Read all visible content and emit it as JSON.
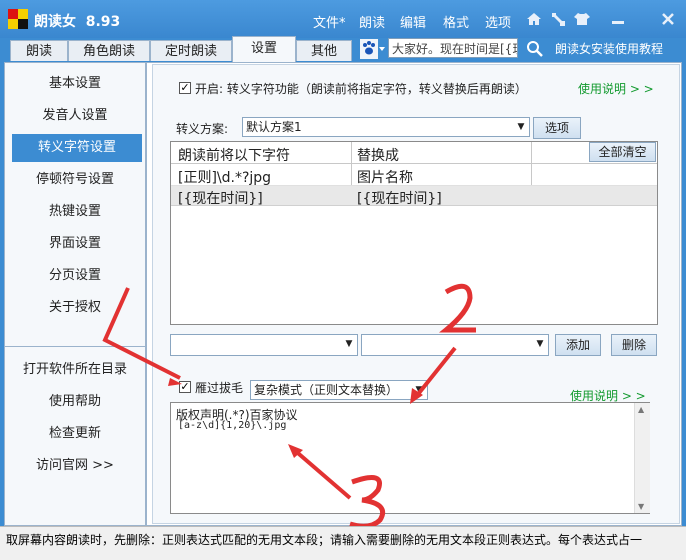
{
  "window": {
    "title": "朗读女  8.93",
    "menu": [
      "文件*",
      "朗读",
      "编辑",
      "格式",
      "选项"
    ]
  },
  "toolbar_icons": [
    "home-icon",
    "tools-icon",
    "shirt-icon",
    "minimize-icon",
    "close-icon"
  ],
  "tabs": [
    {
      "label": "朗读",
      "active": false
    },
    {
      "label": "角色朗读",
      "active": false
    },
    {
      "label": "定时朗读",
      "active": false
    },
    {
      "label": "设置",
      "active": true
    },
    {
      "label": "其他",
      "active": false
    }
  ],
  "search": {
    "value": "大家好。现在时间是[{现"
  },
  "top_help_link": "朗读女安装使用教程",
  "sidebar": {
    "items": [
      {
        "label": "基本设置",
        "selected": false
      },
      {
        "label": "发音人设置",
        "selected": false
      },
      {
        "label": "转义字符设置",
        "selected": true
      },
      {
        "label": "停顿符号设置",
        "selected": false
      },
      {
        "label": "热键设置",
        "selected": false
      },
      {
        "label": "界面设置",
        "selected": false
      },
      {
        "label": "分页设置",
        "selected": false
      },
      {
        "label": "关于授权",
        "selected": false
      }
    ],
    "bottom_items": [
      "打开软件所在目录",
      "使用帮助",
      "检查更新",
      "访问官网 >>"
    ]
  },
  "escape": {
    "enable_checked": true,
    "enable_label": "开启: 转义字符功能（朗读前将指定字符，转义替换后再朗读）",
    "help_link": "使用说明 > >",
    "scheme_label": "转义方案:",
    "scheme_value": "默认方案1",
    "options_button": "选项",
    "clear_all_button": "全部清空",
    "columns": [
      "朗读前将以下字符",
      "替换成"
    ],
    "rows": [
      [
        "[正则]\\d.*?jpg",
        "图片名称"
      ],
      [
        "[{现在时间}]",
        "[{现在时间}]"
      ]
    ],
    "add_button": "添加",
    "delete_button": "删除"
  },
  "filter": {
    "checked": true,
    "label": "雁过拔毛",
    "mode_value": "复杂模式（正则文本替换）",
    "help_link": "使用说明 > >",
    "text_lines": [
      "版权声明(.*?)百家协议",
      "[a-z\\d]{1,20}\\.jpg"
    ]
  },
  "status_text": "取屏幕内容朗读时，先删除：正则表达式匹配的无用文本段；请输入需要删除的无用文本段正则表达式。每个表达式占一",
  "annotations": [
    "1",
    "2",
    "3"
  ],
  "colors": {
    "accent": "#3c8cd2",
    "link_green": "#129a2e",
    "annotation_red": "#e23232"
  }
}
